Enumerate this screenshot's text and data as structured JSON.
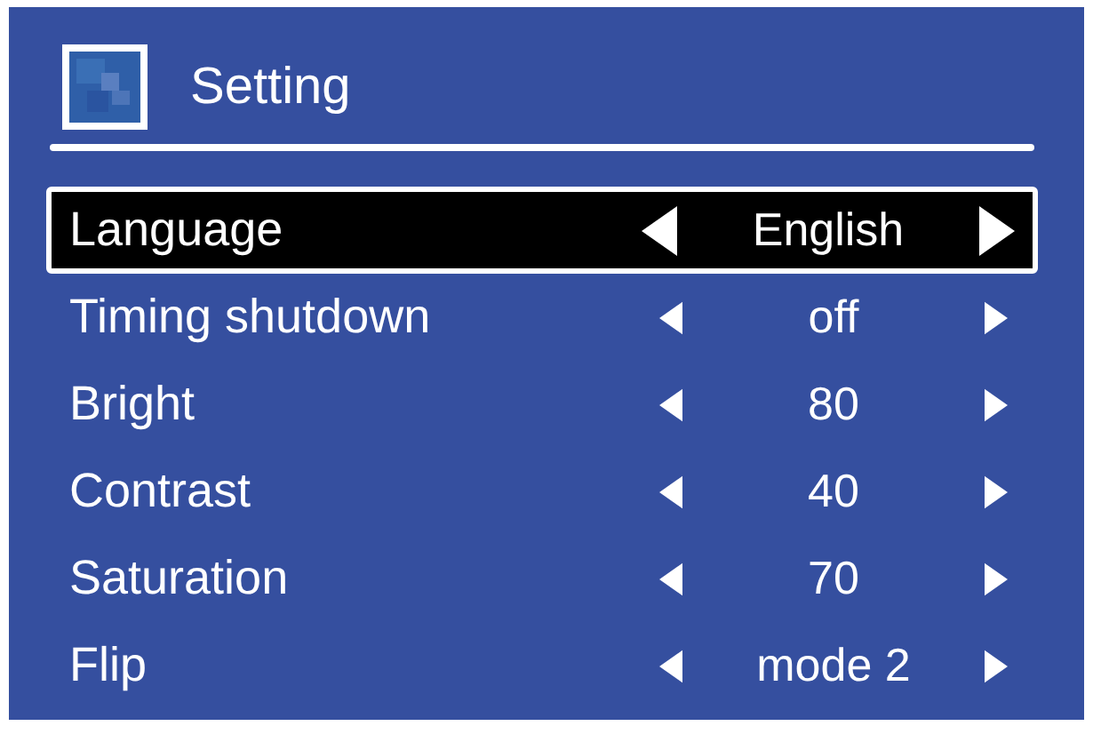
{
  "header": {
    "title": "Setting"
  },
  "rows": [
    {
      "label": "Language",
      "value": "English",
      "selected": true
    },
    {
      "label": "Timing shutdown",
      "value": "off",
      "selected": false
    },
    {
      "label": "Bright",
      "value": "80",
      "selected": false
    },
    {
      "label": "Contrast",
      "value": "40",
      "selected": false
    },
    {
      "label": "Saturation",
      "value": "70",
      "selected": false
    },
    {
      "label": "Flip",
      "value": "mode 2",
      "selected": false
    }
  ]
}
